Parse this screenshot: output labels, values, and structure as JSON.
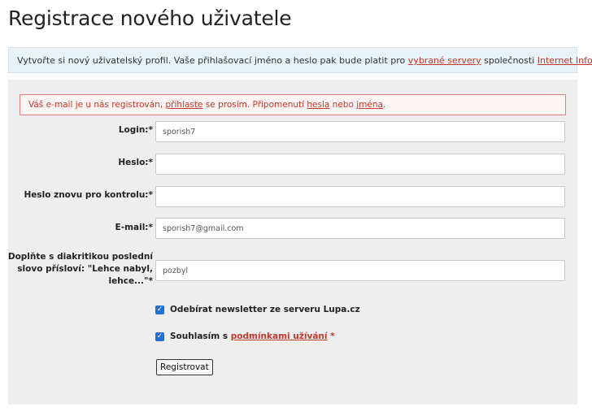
{
  "page": {
    "title": "Registrace nového uživatele"
  },
  "info": {
    "text_before": "Vytvořte si nový uživatelský profil. Vaše přihlašovací jméno a heslo pak bude platit pro ",
    "link_servers": "vybrané servery",
    "text_middle": " společnosti ",
    "link_company": "Internet Info",
    "text_after": "."
  },
  "error": {
    "text_1": "Váš e-mail je u nás registrován, ",
    "link_login": "přihlaste",
    "text_2": " se prosím. Připomenutí ",
    "link_password": "hesla",
    "text_3": " nebo ",
    "link_name": "jména",
    "text_4": "."
  },
  "form": {
    "login_label": "Login:*",
    "login_value": "sporish7",
    "password_label": "Heslo:*",
    "password_value": "",
    "password2_label": "Heslo znovu pro kontrolu:*",
    "password2_value": "",
    "email_label": "E-mail:*",
    "email_value": "sporish7@gmail.com",
    "proverb_label": "Doplňte s diakritikou poslední slovo přísloví: \"Lehce nabyl, lehce...\"*",
    "proverb_value": "pozbyl",
    "newsletter_label": "Odebírat newsletter ze serveru Lupa.cz",
    "newsletter_checked": true,
    "terms_text": "Souhlasím s ",
    "terms_link": "podmínkami užívání",
    "terms_required": " *",
    "terms_checked": true,
    "submit_label": "Registrovat"
  },
  "colors": {
    "link": "#c0392b",
    "checkbox": "#1e6fd9",
    "info_bg": "#e9f2f7",
    "panel_bg": "#eeeeee"
  }
}
